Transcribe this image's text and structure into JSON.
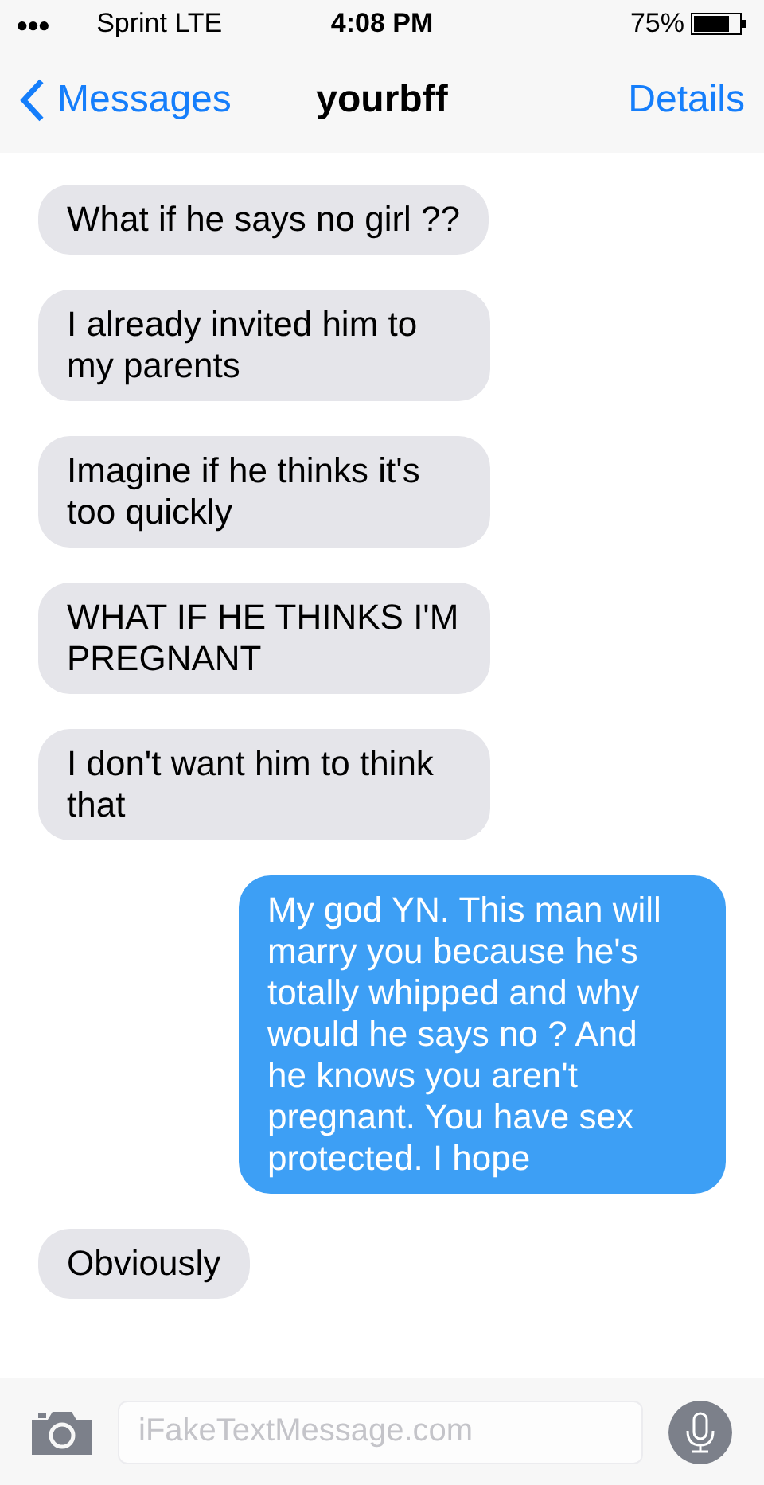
{
  "status_bar": {
    "signal": "●●●",
    "carrier": "Sprint  LTE",
    "time": "4:08 PM",
    "battery": "75%"
  },
  "nav": {
    "back": "Messages",
    "title": "yourbff",
    "action": "Details"
  },
  "messages": [
    {
      "kind": "received",
      "text": "What if he says no girl ??"
    },
    {
      "kind": "received",
      "text": "I already invited him to my parents"
    },
    {
      "kind": "received",
      "text": "Imagine if he thinks it's too quickly"
    },
    {
      "kind": "received",
      "text": "WHAT IF HE THINKS I'M PREGNANT"
    },
    {
      "kind": "received",
      "text": "I don't want him to think that"
    },
    {
      "kind": "sent",
      "text": "My god YN. This man will marry you because he's totally whipped and why would he says no ? And he knows you aren't pregnant. You have sex protected. I hope"
    },
    {
      "kind": "received",
      "text": "Obviously"
    }
  ],
  "composer": {
    "placeholder": "iFakeTextMessage.com"
  }
}
